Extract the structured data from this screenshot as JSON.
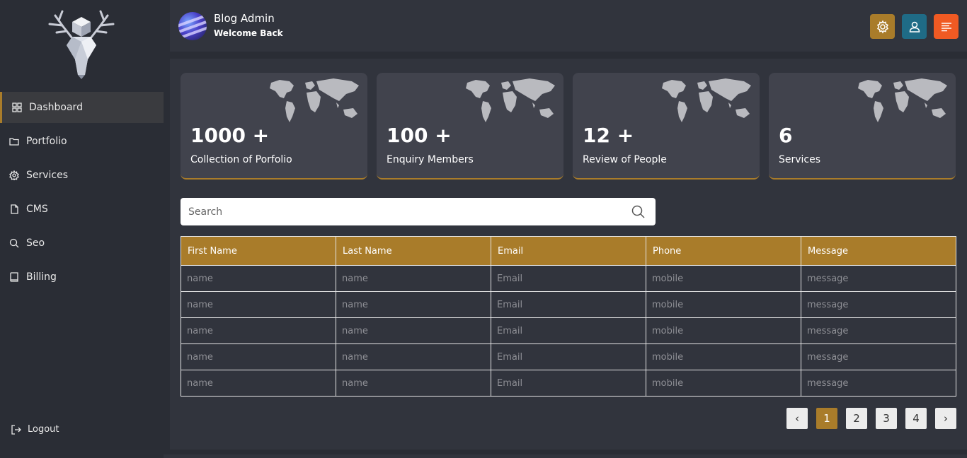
{
  "header": {
    "title": "Blog Admin",
    "subtitle": "Welcome Back",
    "buttons": [
      {
        "icon": "gear-icon",
        "color": "#a97c2a"
      },
      {
        "icon": "user-icon",
        "color": "#1f6b86"
      },
      {
        "icon": "menu-lines-icon",
        "color": "#f05a23"
      }
    ]
  },
  "sidebar": {
    "logo": "stag-head-logo",
    "items": [
      {
        "label": "Dashboard",
        "icon": "grid-icon",
        "active": true
      },
      {
        "label": "Portfolio",
        "icon": "folder-icon"
      },
      {
        "label": "Services",
        "icon": "gear-icon"
      },
      {
        "label": "CMS",
        "icon": "file-icon"
      },
      {
        "label": "Seo",
        "icon": "search-icon"
      },
      {
        "label": "Billing",
        "icon": "book-icon"
      }
    ],
    "logout": "Logout"
  },
  "cards": [
    {
      "value": "1000 +",
      "label": "Collection of Porfolio"
    },
    {
      "value": "100 +",
      "label": "Enquiry Members"
    },
    {
      "value": "12 +",
      "label": "Review of People"
    },
    {
      "value": "6",
      "label": "Services"
    }
  ],
  "search": {
    "placeholder": "Search"
  },
  "table": {
    "headers": [
      "First Name",
      "Last Name",
      "Email",
      "Phone",
      "Message"
    ],
    "rows": [
      [
        "name",
        "name",
        "Email",
        "mobile",
        "message"
      ],
      [
        "name",
        "name",
        "Email",
        "mobile",
        "message"
      ],
      [
        "name",
        "name",
        "Email",
        "mobile",
        "message"
      ],
      [
        "name",
        "name",
        "Email",
        "mobile",
        "message"
      ],
      [
        "name",
        "name",
        "Email",
        "mobile",
        "message"
      ]
    ]
  },
  "pagination": {
    "prev": "‹",
    "pages": [
      "1",
      "2",
      "3",
      "4"
    ],
    "current": "1",
    "next": "›"
  },
  "colors": {
    "accent": "#a97c2a",
    "background": "#2a2d35",
    "panel": "#31343d",
    "card": "#41434d"
  }
}
